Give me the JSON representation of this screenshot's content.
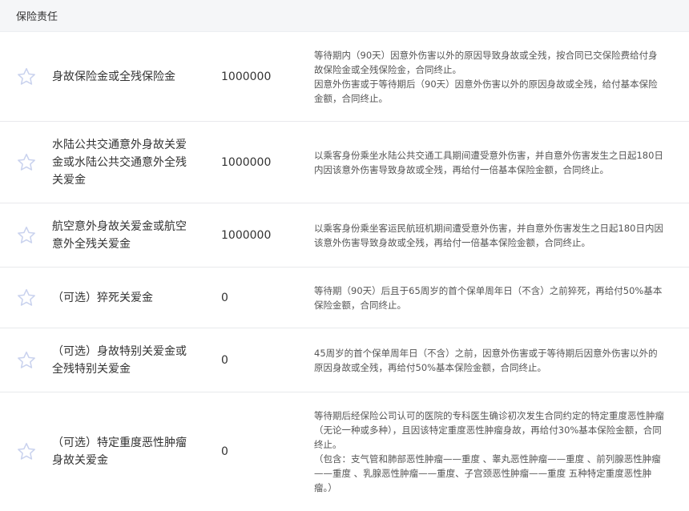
{
  "header": {
    "title": "保险责任"
  },
  "rows": [
    {
      "name": "身故保险金或全残保险金",
      "amount": "1000000",
      "desc": "等待期内（90天）因意外伤害以外的原因导致身故或全残，按合同已交保险费给付身故保险金或全残保险金，合同终止。\n因意外伤害或于等待期后（90天）因意外伤害以外的原因身故或全残，给付基本保险金额，合同终止。"
    },
    {
      "name": "水陆公共交通意外身故关爱金或水陆公共交通意外全残关爱金",
      "amount": "1000000",
      "desc": "以乘客身份乘坐水陆公共交通工具期间遭受意外伤害，并自意外伤害发生之日起180日内因该意外伤害导致身故或全残，再给付一倍基本保险金额，合同终止。"
    },
    {
      "name": "航空意外身故关爱金或航空意外全残关爱金",
      "amount": "1000000",
      "desc": "以乘客身份乘坐客运民航班机期间遭受意外伤害，并自意外伤害发生之日起180日内因该意外伤害导致身故或全残，再给付一倍基本保险金额，合同终止。"
    },
    {
      "name": "（可选）猝死关爱金",
      "amount": "0",
      "desc": "等待期（90天）后且于65周岁的首个保单周年日（不含）之前猝死，再给付50%基本保险金额，合同终止。"
    },
    {
      "name": "（可选）身故特别关爱金或全残特别关爱金",
      "amount": "0",
      "desc": "45周岁的首个保单周年日（不含）之前，因意外伤害或于等待期后因意外伤害以外的原因身故或全残，再给付50%基本保险金额，合同终止。"
    },
    {
      "name": "（可选）特定重度恶性肿瘤身故关爱金",
      "amount": "0",
      "desc": "等待期后经保险公司认可的医院的专科医生确诊初次发生合同约定的特定重度恶性肿瘤（无论一种或多种），且因该特定重度恶性肿瘤身故，再给付30%基本保险金额，合同终止。\n（包含：支气管和肺部恶性肿瘤——重度 、睾丸恶性肿瘤——重度 、前列腺恶性肿瘤——重度 、乳腺恶性肿瘤——重度、子宫颈恶性肿瘤——重度 五种特定重度恶性肿瘤。）"
    }
  ],
  "icons": {
    "favorite": "star-outline-icon"
  },
  "colors": {
    "star": "#c9d2ee",
    "header_bg": "#f5f6f8"
  }
}
